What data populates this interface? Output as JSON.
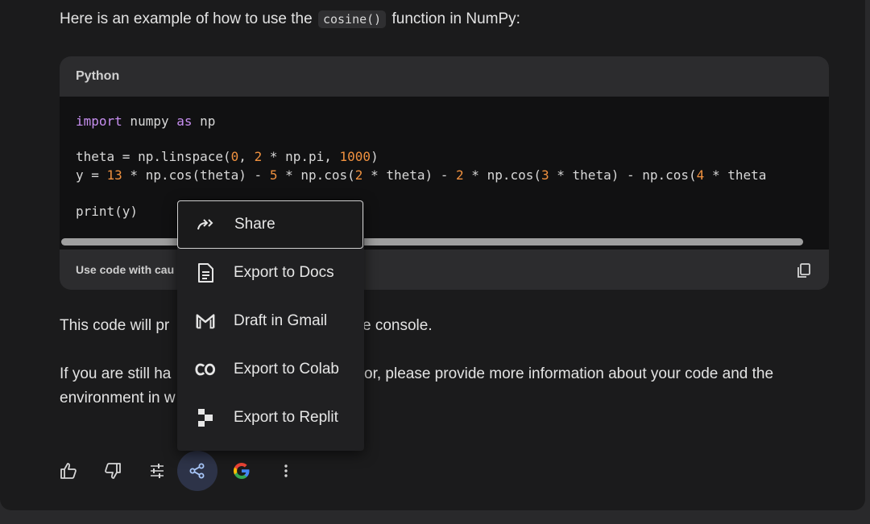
{
  "intro": {
    "before": "Here is an example of how to use the",
    "code": "cosine()",
    "after": "function in NumPy:"
  },
  "code_block": {
    "language": "Python",
    "lines": {
      "l1": {
        "kw1": "import",
        "t1": " numpy ",
        "kw2": "as",
        "t2": " np"
      },
      "l2": {
        "a": "theta = np.linspace(",
        "n1": "0",
        "b": ", ",
        "n2": "2",
        "c": " * np.pi, ",
        "n3": "1000",
        "d": ")"
      },
      "l3": {
        "a": "y = ",
        "n1": "13",
        "b": " * np.cos(theta) - ",
        "n2": "5",
        "c": " * np.cos(",
        "n3": "2",
        "d": " * theta) - ",
        "n4": "2",
        "e": " * np.cos(",
        "n5": "3",
        "f": " * theta) - np.cos(",
        "n6": "4",
        "g": " * theta"
      },
      "l4": "print(y)"
    },
    "footer_note": "Use code with cau",
    "copy_icon": "copy-icon"
  },
  "paragraphs": {
    "p1_left": "This code will pr",
    "p1_right": "e console.",
    "p2_left": "If you are still ha",
    "p2_right": "or, please provide more information about your code and the",
    "p3_left": "environment in w"
  },
  "share_menu": {
    "items": [
      {
        "label": "Share",
        "icon": "share-arrow-icon"
      },
      {
        "label": "Export to Docs",
        "icon": "docs-icon"
      },
      {
        "label": "Draft in Gmail",
        "icon": "gmail-icon"
      },
      {
        "label": "Export to Colab",
        "icon": "colab-icon"
      },
      {
        "label": "Export to Replit",
        "icon": "replit-icon"
      }
    ]
  },
  "actions": [
    "thumbs-up-icon",
    "thumbs-down-icon",
    "tune-icon",
    "share-icon",
    "google-icon",
    "more-vert-icon"
  ],
  "colors": {
    "accent_share_bg": "#2d3348",
    "keyword": "#c78ff0",
    "number": "#f0913f"
  }
}
